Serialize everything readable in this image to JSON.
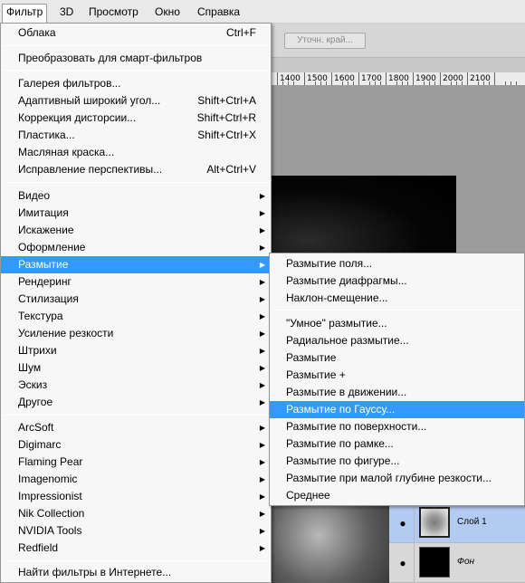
{
  "menubar": {
    "items": [
      "Фильтр",
      "3D",
      "Просмотр",
      "Окно",
      "Справка"
    ]
  },
  "options_bar": {
    "refine_edge": "Уточн. край..."
  },
  "ruler": {
    "labels": [
      "1400",
      "1500",
      "1600",
      "1700",
      "1800",
      "1900",
      "2000",
      "2100"
    ]
  },
  "filter_menu": {
    "items": [
      {
        "label": "Облака",
        "shortcut": "Ctrl+F"
      },
      {
        "label": "Преобразовать для смарт-фильтров"
      },
      {
        "label": "Галерея фильтров..."
      },
      {
        "label": "Адаптивный широкий угол...",
        "shortcut": "Shift+Ctrl+A"
      },
      {
        "label": "Коррекция дисторсии...",
        "shortcut": "Shift+Ctrl+R"
      },
      {
        "label": "Пластика...",
        "shortcut": "Shift+Ctrl+X"
      },
      {
        "label": "Масляная краска..."
      },
      {
        "label": "Исправление перспективы...",
        "shortcut": "Alt+Ctrl+V"
      },
      {
        "label": "Видео"
      },
      {
        "label": "Имитация"
      },
      {
        "label": "Искажение"
      },
      {
        "label": "Оформление"
      },
      {
        "label": "Размытие"
      },
      {
        "label": "Рендеринг"
      },
      {
        "label": "Стилизация"
      },
      {
        "label": "Текстура"
      },
      {
        "label": "Усиление резкости"
      },
      {
        "label": "Штрихи"
      },
      {
        "label": "Шум"
      },
      {
        "label": "Эскиз"
      },
      {
        "label": "Другое"
      },
      {
        "label": "ArcSoft"
      },
      {
        "label": "Digimarc"
      },
      {
        "label": "Flaming Pear"
      },
      {
        "label": "Imagenomic"
      },
      {
        "label": "Impressionist"
      },
      {
        "label": "Nik Collection"
      },
      {
        "label": "NVIDIA Tools"
      },
      {
        "label": "Redfield"
      },
      {
        "label": "Найти фильтры в Интернете..."
      }
    ]
  },
  "blur_submenu": {
    "items": [
      "Размытие поля...",
      "Размытие диафрагмы...",
      "Наклон-смещение...",
      "\"Умное\" размытие...",
      "Радиальное размытие...",
      "Размытие",
      "Размытие +",
      "Размытие в движении...",
      "Размытие по Гауссу...",
      "Размытие по поверхности...",
      "Размытие по рамке...",
      "Размытие по фигуре...",
      "Размытие при малой глубине резкости...",
      "Среднее"
    ]
  },
  "layers": [
    {
      "name": "Слой 1"
    },
    {
      "name": "Фон"
    }
  ],
  "colors": {
    "highlight": "#3399ff",
    "layer_selected": "#b3cbf0"
  }
}
